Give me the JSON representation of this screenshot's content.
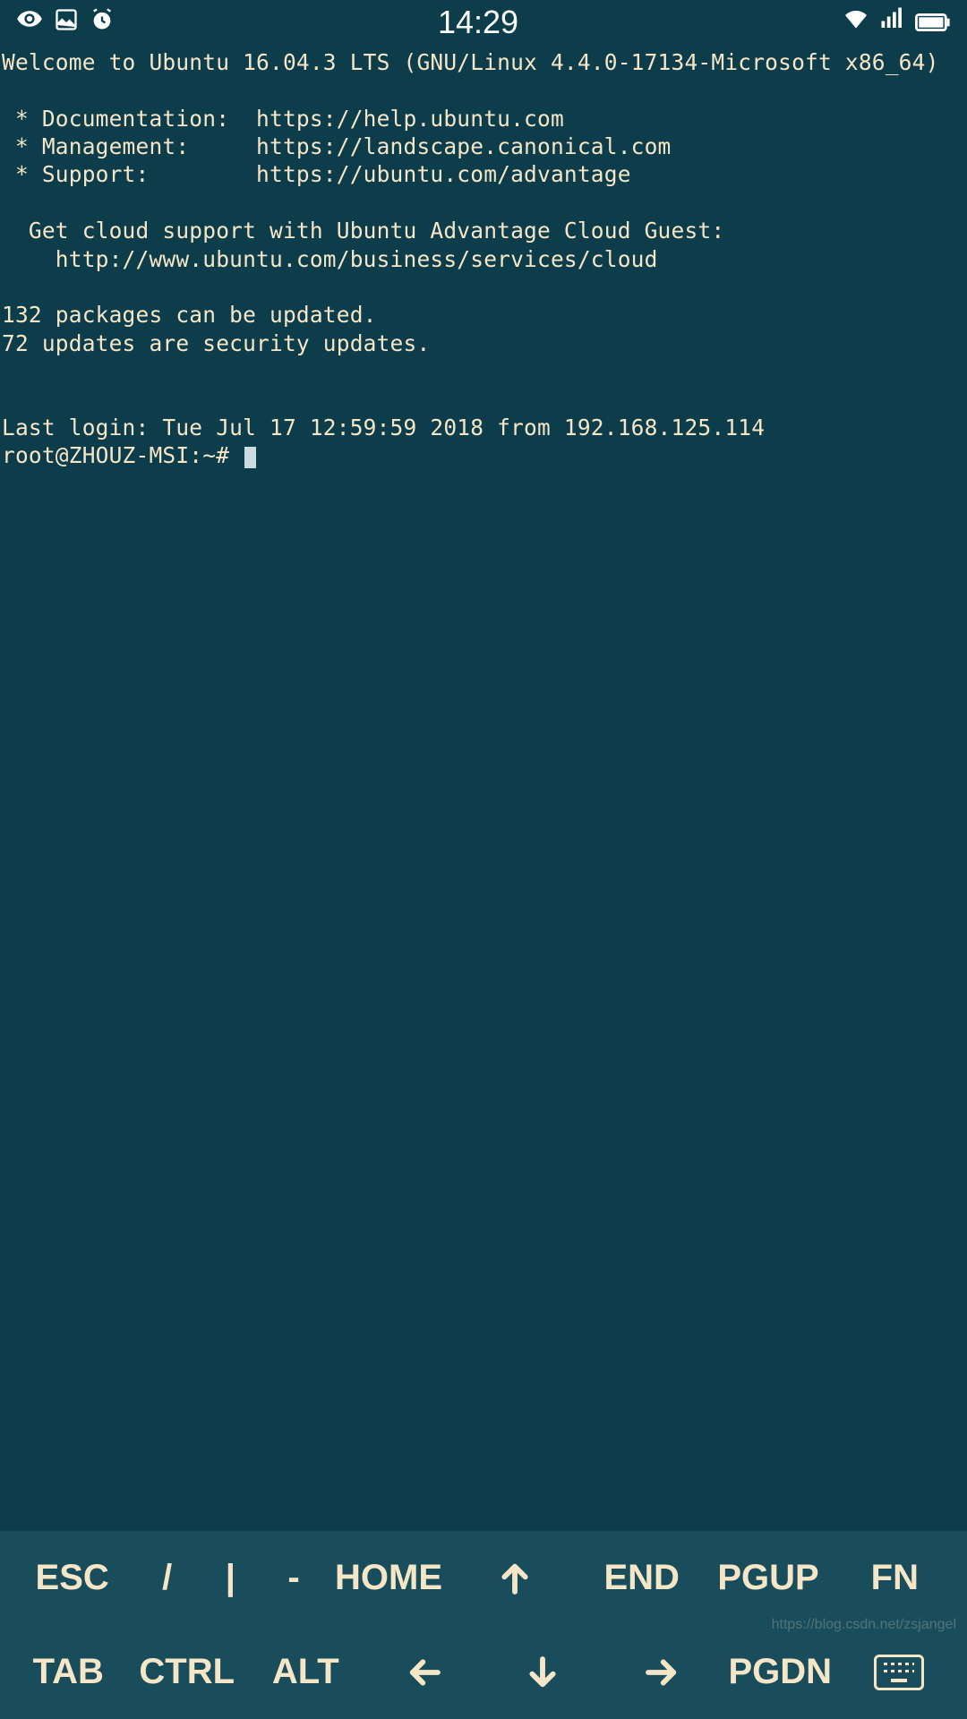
{
  "status_bar": {
    "time": "14:29"
  },
  "terminal": {
    "line_welcome": "Welcome to Ubuntu 16.04.3 LTS (GNU/Linux 4.4.0-17134-Microsoft x86_64)",
    "line_doc": " * Documentation:  https://help.ubuntu.com",
    "line_mgmt": " * Management:     https://landscape.canonical.com",
    "line_support": " * Support:        https://ubuntu.com/advantage",
    "line_cloud1": "  Get cloud support with Ubuntu Advantage Cloud Guest:",
    "line_cloud2": "    http://www.ubuntu.com/business/services/cloud",
    "line_pkg1": "132 packages can be updated.",
    "line_pkg2": "72 updates are security updates.",
    "line_lastlogin": "Last login: Tue Jul 17 12:59:59 2018 from 192.168.125.114",
    "prompt": "root@ZHOUZ-MSI:~# "
  },
  "keys": {
    "row1": {
      "esc": "ESC",
      "slash": "/",
      "pipe": "|",
      "dash": "-",
      "home": "HOME",
      "end": "END",
      "pgup": "PGUP",
      "fn": "FN"
    },
    "row2": {
      "tab": "TAB",
      "ctrl": "CTRL",
      "alt": "ALT",
      "pgdn": "PGDN"
    }
  },
  "watermark": "https://blog.csdn.net/zsjangel"
}
